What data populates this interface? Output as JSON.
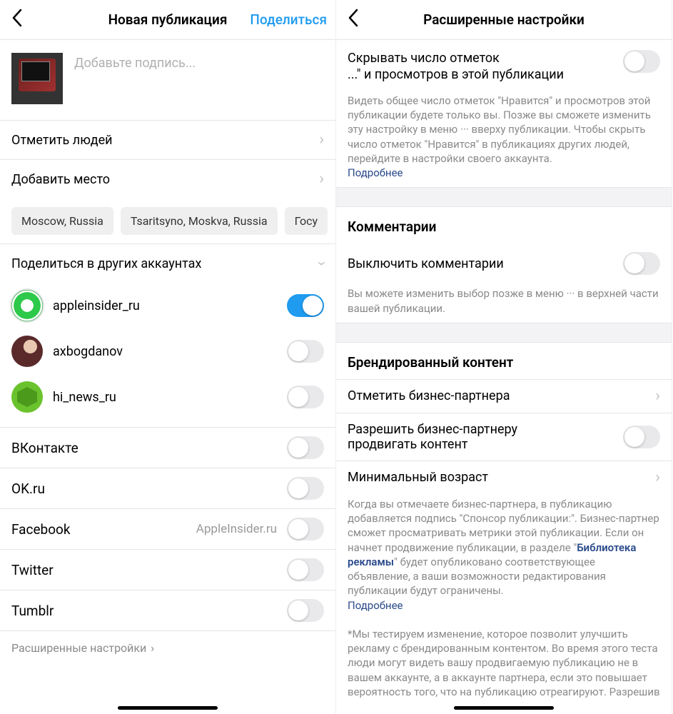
{
  "left": {
    "header": {
      "title": "Новая публикация",
      "action": "Поделиться"
    },
    "caption_placeholder": "Добавьте подпись...",
    "rows": {
      "tag_people": "Отметить людей",
      "add_location": "Добавить место"
    },
    "location_chips": [
      "Moscow, Russia",
      "Tsaritsyno, Moskva, Russia",
      "Госу"
    ],
    "share_other_title": "Поделиться в других аккаунтах",
    "accounts": [
      {
        "name": "appleinsider_ru",
        "on": true,
        "avatar": "green-ring"
      },
      {
        "name": "axbogdanov",
        "on": false,
        "avatar": "person"
      },
      {
        "name": "hi_news_ru",
        "on": false,
        "avatar": "hex"
      }
    ],
    "externals": [
      {
        "name": "ВКонтакте",
        "on": false,
        "sub": ""
      },
      {
        "name": "OK.ru",
        "on": false,
        "sub": ""
      },
      {
        "name": "Facebook",
        "on": false,
        "sub": "AppleInsider.ru"
      },
      {
        "name": "Twitter",
        "on": false,
        "sub": ""
      },
      {
        "name": "Tumblr",
        "on": false,
        "sub": ""
      }
    ],
    "advanced_link": "Расширенные настройки"
  },
  "right": {
    "header": {
      "title": "Расширенные настройки"
    },
    "hide_likes": {
      "line1": "Скрывать число отметок",
      "line2": "...\" и просмотров в этой публикации",
      "desc": "Видеть общее число отметок \"Нравится\" и просмотров этой публикации будете только вы. Позже вы сможете изменить эту настройку в меню ··· вверху публикации. Чтобы скрыть число отметок \"Нравится\" в публикациях других людей, перейдите в настройки своего аккаунта.",
      "more": "Подробнее"
    },
    "comments": {
      "section": "Комментарии",
      "toggle_label": "Выключить комментарии",
      "desc": "Вы можете изменить выбор позже в меню ··· в верхней части вашей публикации."
    },
    "branded": {
      "section": "Брендированный контент",
      "tag_partner": "Отметить бизнес-партнера",
      "allow_promote_l1": "Разрешить бизнес-партнеру",
      "allow_promote_l2": "продвигать контент",
      "min_age": "Минимальный возраст",
      "desc_pre": "Когда вы отмечаете бизнес-партнера, в публикацию добавляется подпись \"Спонсор публикации:\". Бизнес-партнер сможет просматривать метрики этой публикации. Если он начнет продвижение публикации, в разделе \"",
      "desc_link": "Библиотека рекламы",
      "desc_post": "\" будет опубликовано соответствующее объявление, а ваши возможности редактирования публикации будут ограничены.",
      "more": "Подробнее",
      "footnote": "*Мы тестируем изменение, которое позволит улучшить рекламу с брендированным контентом. Во время этого теста люди могут видеть вашу продвигаемую публикацию не в вашем аккаунте, а в аккаунте партнера, если это повышает вероятность того, что на публикацию отреагируют. Разрешив"
    }
  }
}
